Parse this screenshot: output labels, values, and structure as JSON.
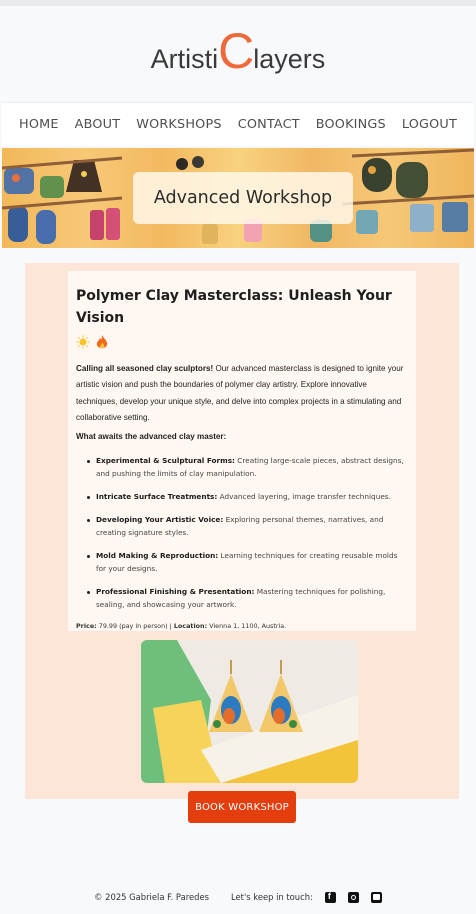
{
  "brand": {
    "logo_part1": "Artisti",
    "logo_big": "C",
    "logo_part2": "layers",
    "accent": "#ef6a3a"
  },
  "nav": {
    "items": [
      {
        "label": "HOME"
      },
      {
        "label": "ABOUT"
      },
      {
        "label": "WORKSHOPS"
      },
      {
        "label": "CONTACT"
      },
      {
        "label": "BOOKINGS"
      },
      {
        "label": "LOGOUT"
      }
    ]
  },
  "hero": {
    "title": "Advanced Workshop"
  },
  "workshop": {
    "title": "Polymer Clay Masterclass: Unleash Your Vision",
    "emoji_1": "☀️",
    "emoji_2": "🔥",
    "intro_bold": "Calling all seasoned clay sculptors!",
    "intro_text": " Our advanced masterclass is designed to ignite your artistic vision and push the boundaries of polymer clay artistry. Explore innovative techniques, develop your unique style, and delve into complex projects in a stimulating and collaborative setting.",
    "awaits_heading": "What awaits the advanced clay master:",
    "features": [
      {
        "title": "Experimental & Sculptural Forms:",
        "text": " Creating large-scale pieces, abstract designs, and pushing the limits of clay manipulation."
      },
      {
        "title": "Intricate Surface Treatments:",
        "text": " Advanced layering, image transfer techniques."
      },
      {
        "title": "Developing Your Artistic Voice:",
        "text": " Exploring personal themes, narratives, and creating signature styles."
      },
      {
        "title": "Mold Making & Reproduction:",
        "text": " Learning techniques for creating reusable molds for your designs."
      },
      {
        "title": "Professional Finishing & Presentation:",
        "text": " Mastering techniques for polishing, sealing, and showcasing your artwork."
      }
    ],
    "price_label": "Price:",
    "price_value": " 79.99 (pay in person) | ",
    "location_label": "Location:",
    "location_value": " Vienna 1, 1100, Austria."
  },
  "actions": {
    "book_label": "BOOK WORKSHOP",
    "button_color": "#e43e0e"
  },
  "footer": {
    "copyright": "© 2025 Gabriela F. Paredes",
    "touch": "Let's keep in touch:",
    "socials": [
      "facebook-icon",
      "instagram-icon",
      "youtube-icon"
    ]
  }
}
